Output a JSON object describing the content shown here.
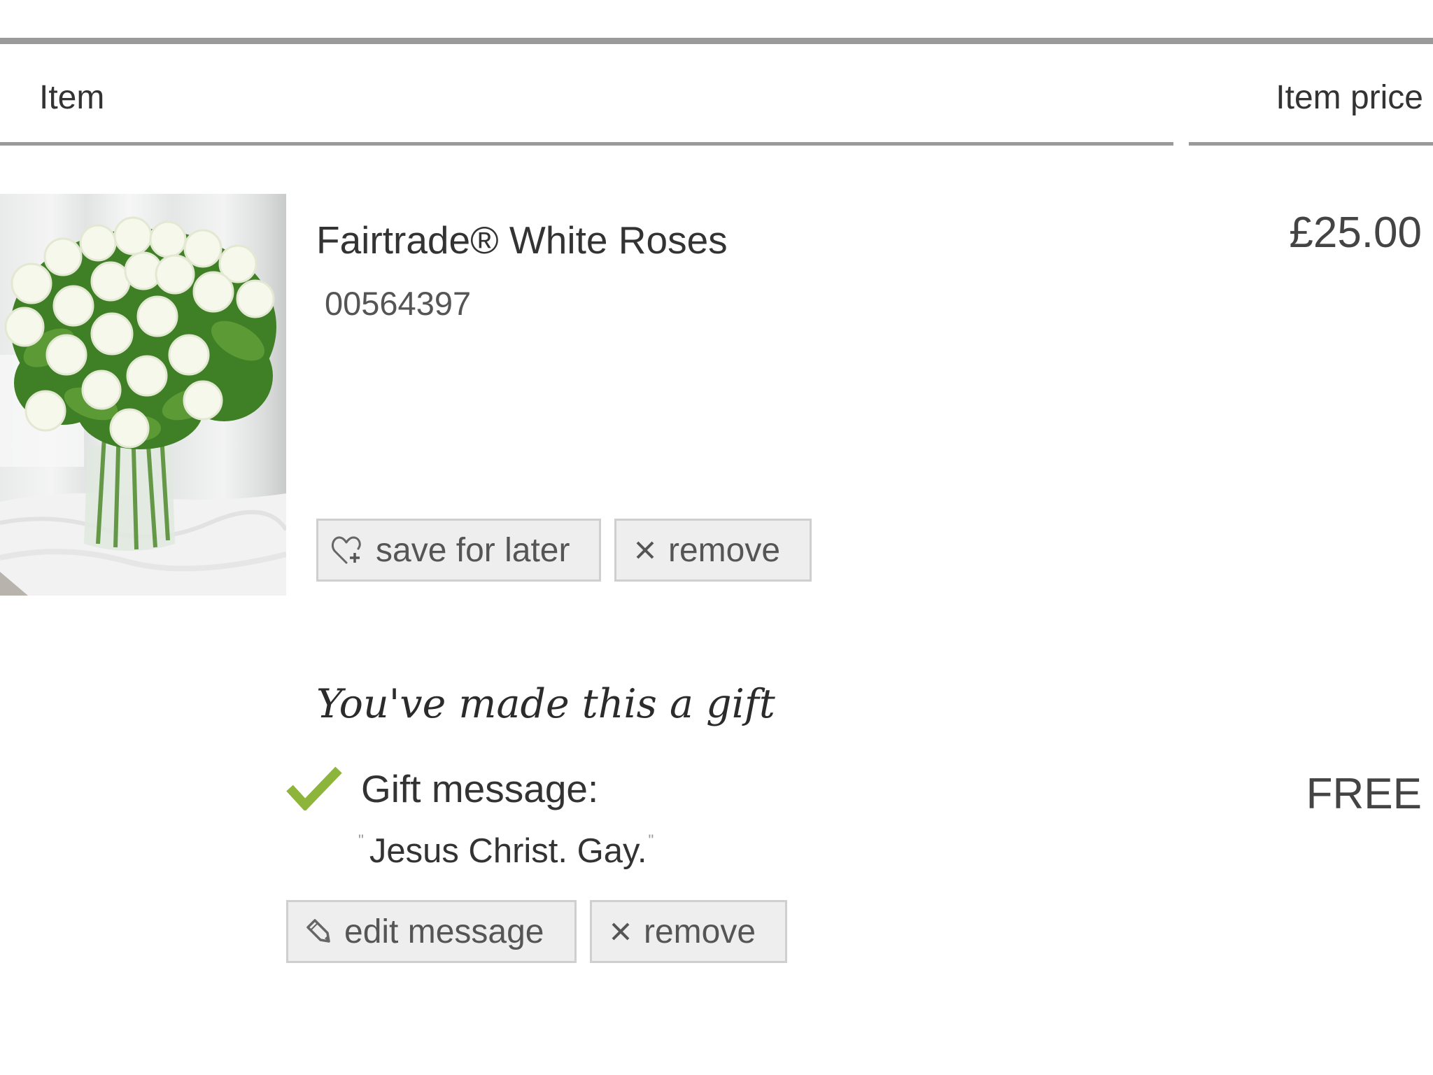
{
  "table": {
    "columns": [
      "Item",
      "Item price"
    ]
  },
  "product": {
    "image_alt": "White roses bouquet in glass vase",
    "title": "Fairtrade® White Roses",
    "sku": "00564397",
    "price": "£25.00",
    "actions": {
      "save_label": "save for later",
      "save_icon": "heart-plus-icon",
      "remove_label": "remove",
      "remove_icon": "close-icon"
    }
  },
  "gift": {
    "heading": "You've made this a gift",
    "status_icon": "check-icon",
    "message_label": "Gift message:",
    "open_quote": "\"",
    "message": "Jesus Christ. Gay.",
    "close_quote": "\"",
    "price": "FREE",
    "actions": {
      "edit_label": "edit message",
      "edit_icon": "pencil-icon",
      "remove_label": "remove",
      "remove_icon": "close-icon"
    }
  },
  "colors": {
    "rule": "#9a9a9a",
    "button_bg": "#eeeeee",
    "button_border": "#cfcfcf",
    "check_green": "#8db53c",
    "text_dark": "#333333",
    "text_muted": "#555555"
  }
}
